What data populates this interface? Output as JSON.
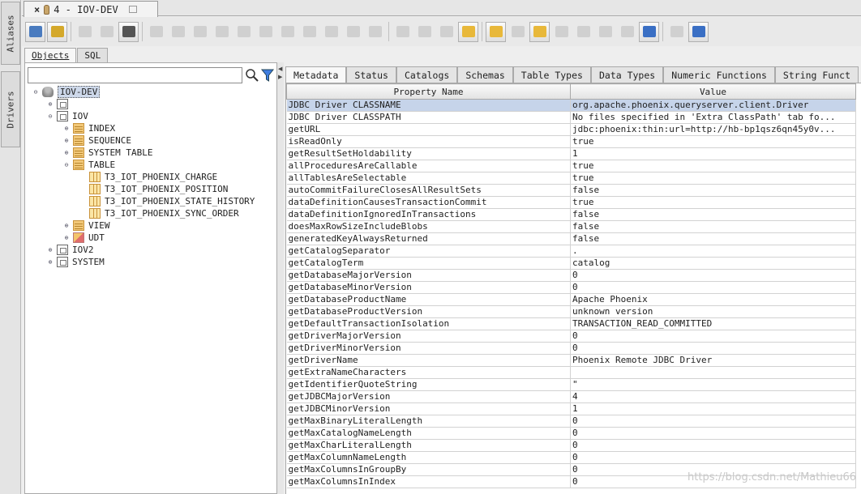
{
  "sidebar": {
    "tabs": [
      {
        "label": "Aliases"
      },
      {
        "label": "Drivers"
      }
    ]
  },
  "doc_tab": {
    "close_glyph": "×",
    "title": "4 - IOV-DEV"
  },
  "toolbar": {
    "buttons": [
      {
        "icon": "session-properties-icon",
        "enabled": true,
        "color": "#4a7bbf"
      },
      {
        "icon": "refresh-icon",
        "enabled": true,
        "color": "#d4a82a"
      },
      {
        "icon": "run-icon",
        "enabled": false,
        "color": "#b0b0b0"
      },
      {
        "icon": "stop-icon",
        "enabled": false,
        "color": "#b0b0b0"
      },
      {
        "icon": "commit-icon",
        "enabled": true,
        "color": "#555555"
      },
      {
        "icon": "open-file-icon",
        "enabled": false,
        "color": "#b0b0b0"
      },
      {
        "icon": "new-file-icon",
        "enabled": false,
        "color": "#b0b0b0"
      },
      {
        "icon": "open-icon",
        "enabled": false,
        "color": "#b0b0b0"
      },
      {
        "icon": "print-icon",
        "enabled": false,
        "color": "#b0b0b0"
      },
      {
        "icon": "copy-icon",
        "enabled": false,
        "color": "#b0b0b0"
      },
      {
        "icon": "save-icon",
        "enabled": false,
        "color": "#b0b0b0"
      },
      {
        "icon": "save-as-icon",
        "enabled": false,
        "color": "#b0b0b0"
      },
      {
        "icon": "delete-icon",
        "enabled": false,
        "color": "#b0b0b0"
      },
      {
        "icon": "cut-icon",
        "enabled": false,
        "color": "#b0b0b0"
      },
      {
        "icon": "paste-icon",
        "enabled": false,
        "color": "#b0b0b0"
      },
      {
        "icon": "up-icon",
        "enabled": false,
        "color": "#b0b0b0"
      },
      {
        "icon": "down-icon",
        "enabled": false,
        "color": "#b0b0b0"
      },
      {
        "icon": "list-icon",
        "enabled": false,
        "color": "#b0b0b0"
      },
      {
        "icon": "edit-icon",
        "enabled": false,
        "color": "#b0b0b0"
      },
      {
        "icon": "layout-icon",
        "enabled": true,
        "color": "#e8b83a"
      },
      {
        "icon": "window-icon",
        "enabled": true,
        "color": "#e8b83a"
      },
      {
        "icon": "tile-icon",
        "enabled": false,
        "color": "#b0b0b0"
      },
      {
        "icon": "cascade-icon",
        "enabled": true,
        "color": "#e8b83a"
      },
      {
        "icon": "bookmark-icon",
        "enabled": false,
        "color": "#b0b0b0"
      },
      {
        "icon": "bookmark-add-icon",
        "enabled": false,
        "color": "#b0b0b0"
      },
      {
        "icon": "find-icon",
        "enabled": false,
        "color": "#b0b0b0"
      },
      {
        "icon": "replace-icon",
        "enabled": false,
        "color": "#b0b0b0"
      },
      {
        "icon": "sync-icon",
        "enabled": true,
        "color": "#3a6fc4"
      },
      {
        "icon": "export-icon",
        "enabled": false,
        "color": "#b0b0b0"
      },
      {
        "icon": "wizard-icon",
        "enabled": true,
        "color": "#3a6fc4"
      }
    ]
  },
  "object_tabs": [
    {
      "label": "Objects"
    },
    {
      "label": "SQL"
    }
  ],
  "filter": {
    "value": "",
    "placeholder": ""
  },
  "tree": [
    {
      "label": "IOV-DEV",
      "depth": 0,
      "toggle": "open",
      "icon": "db-icon",
      "selected": true
    },
    {
      "label": "",
      "depth": 1,
      "toggle": "closed",
      "icon": "schema-icon"
    },
    {
      "label": "IOV",
      "depth": 1,
      "toggle": "open",
      "icon": "schema-icon"
    },
    {
      "label": "INDEX",
      "depth": 2,
      "toggle": "closed",
      "icon": "folder-icon"
    },
    {
      "label": "SEQUENCE",
      "depth": 2,
      "toggle": "closed",
      "icon": "folder-icon"
    },
    {
      "label": "SYSTEM TABLE",
      "depth": 2,
      "toggle": "closed",
      "icon": "folder-icon"
    },
    {
      "label": "TABLE",
      "depth": 2,
      "toggle": "open",
      "icon": "folder-icon"
    },
    {
      "label": "T3_IOT_PHOENIX_CHARGE",
      "depth": 3,
      "toggle": "",
      "icon": "table-icon"
    },
    {
      "label": "T3_IOT_PHOENIX_POSITION",
      "depth": 3,
      "toggle": "",
      "icon": "table-icon"
    },
    {
      "label": "T3_IOT_PHOENIX_STATE_HISTORY",
      "depth": 3,
      "toggle": "",
      "icon": "table-icon"
    },
    {
      "label": "T3_IOT_PHOENIX_SYNC_ORDER",
      "depth": 3,
      "toggle": "",
      "icon": "table-icon"
    },
    {
      "label": "VIEW",
      "depth": 2,
      "toggle": "closed",
      "icon": "folder-icon"
    },
    {
      "label": "UDT",
      "depth": 2,
      "toggle": "closed",
      "icon": "udt-icon"
    },
    {
      "label": "IOV2",
      "depth": 1,
      "toggle": "closed",
      "icon": "schema-icon"
    },
    {
      "label": "SYSTEM",
      "depth": 1,
      "toggle": "closed",
      "icon": "schema-icon"
    }
  ],
  "metadata_tabs": [
    {
      "label": "Metadata"
    },
    {
      "label": "Status"
    },
    {
      "label": "Catalogs"
    },
    {
      "label": "Schemas"
    },
    {
      "label": "Table Types"
    },
    {
      "label": "Data Types"
    },
    {
      "label": "Numeric Functions"
    },
    {
      "label": "String Funct"
    }
  ],
  "table": {
    "columns": [
      "Property Name",
      "Value"
    ],
    "rows": [
      [
        "JDBC Driver CLASSNAME",
        "org.apache.phoenix.queryserver.client.Driver"
      ],
      [
        "JDBC Driver CLASSPATH",
        "No files specified in 'Extra ClassPath' tab fo..."
      ],
      [
        "getURL",
        "jdbc:phoenix:thin:url=http://hb-bp1qsz6qn45y0v..."
      ],
      [
        "isReadOnly",
        "true"
      ],
      [
        "getResultSetHoldability",
        "1"
      ],
      [
        "allProceduresAreCallable",
        "true"
      ],
      [
        "allTablesAreSelectable",
        "true"
      ],
      [
        "autoCommitFailureClosesAllResultSets",
        "false"
      ],
      [
        "dataDefinitionCausesTransactionCommit",
        "true"
      ],
      [
        "dataDefinitionIgnoredInTransactions",
        "false"
      ],
      [
        "doesMaxRowSizeIncludeBlobs",
        "false"
      ],
      [
        "generatedKeyAlwaysReturned",
        "false"
      ],
      [
        "getCatalogSeparator",
        "."
      ],
      [
        "getCatalogTerm",
        "catalog"
      ],
      [
        "getDatabaseMajorVersion",
        "0"
      ],
      [
        "getDatabaseMinorVersion",
        "0"
      ],
      [
        "getDatabaseProductName",
        "Apache Phoenix"
      ],
      [
        "getDatabaseProductVersion",
        "unknown version"
      ],
      [
        "getDefaultTransactionIsolation",
        "TRANSACTION_READ_COMMITTED"
      ],
      [
        "getDriverMajorVersion",
        "0"
      ],
      [
        "getDriverMinorVersion",
        "0"
      ],
      [
        "getDriverName",
        "Phoenix Remote JDBC Driver"
      ],
      [
        "getExtraNameCharacters",
        ""
      ],
      [
        "getIdentifierQuoteString",
        "\""
      ],
      [
        "getJDBCMajorVersion",
        "4"
      ],
      [
        "getJDBCMinorVersion",
        "1"
      ],
      [
        "getMaxBinaryLiteralLength",
        "0"
      ],
      [
        "getMaxCatalogNameLength",
        "0"
      ],
      [
        "getMaxCharLiteralLength",
        "0"
      ],
      [
        "getMaxColumnNameLength",
        "0"
      ],
      [
        "getMaxColumnsInGroupBy",
        "0"
      ],
      [
        "getMaxColumnsInIndex",
        "0"
      ]
    ],
    "selected_row": 0
  },
  "watermark": "https://blog.csdn.net/Mathieu66",
  "colors": {
    "selection": "#c6d4ea",
    "tree_selection": "#cdd8ea",
    "grid": "#d2d2d2"
  }
}
